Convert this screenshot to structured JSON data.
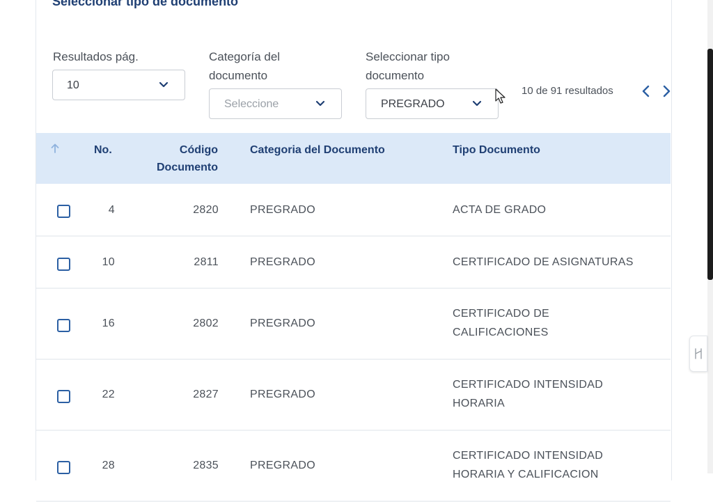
{
  "section": {
    "title": "Seleccionar tipo de documento"
  },
  "filters": {
    "results_per_page": {
      "label": "Resultados pág.",
      "value": "10"
    },
    "category": {
      "label_line1": "Categoría del",
      "label_line2": "documento",
      "placeholder": "Seleccione"
    },
    "doc_type": {
      "label_line1": "Seleccionar tipo",
      "label_line2": "documento",
      "value": "PREGRADO"
    }
  },
  "pagination": {
    "summary": "10 de 91 resultados",
    "prev_icon": "chevron-left-icon",
    "next_icon": "chevron-right-icon"
  },
  "table": {
    "sort_icon": "arrow-up-icon",
    "headers": {
      "no": "No.",
      "code_line1": "Código",
      "code_line2": "Documento",
      "category": "Categoria del Documento",
      "type": "Tipo Documento"
    },
    "rows": [
      {
        "no": "4",
        "code": "2820",
        "category": "PREGRADO",
        "type_line1": "ACTA DE GRADO",
        "type_line2": ""
      },
      {
        "no": "10",
        "code": "2811",
        "category": "PREGRADO",
        "type_line1": "CERTIFICADO DE ASIGNATURAS",
        "type_line2": ""
      },
      {
        "no": "16",
        "code": "2802",
        "category": "PREGRADO",
        "type_line1": "CERTIFICADO DE",
        "type_line2": "CALIFICACIONES"
      },
      {
        "no": "22",
        "code": "2827",
        "category": "PREGRADO",
        "type_line1": "CERTIFICADO INTENSIDAD",
        "type_line2": "HORARIA"
      },
      {
        "no": "28",
        "code": "2835",
        "category": "PREGRADO",
        "type_line1": "CERTIFICADO INTENSIDAD",
        "type_line2": "HORARIA Y CALIFICACION"
      }
    ]
  },
  "colors": {
    "primary": "#1f3f73",
    "header_bg": "#dce9f8",
    "checkbox": "#2b5fa3"
  }
}
